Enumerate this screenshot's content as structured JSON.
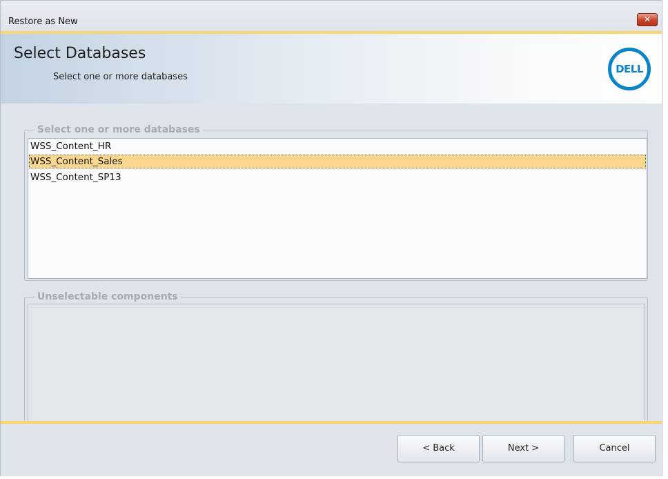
{
  "window": {
    "title": "Restore as New",
    "close_symbol": "✕"
  },
  "header": {
    "title": "Select Databases",
    "subtitle": "Select one or more databases",
    "logo_text": "DELL",
    "logo_color": "#0a84c6"
  },
  "databases_group": {
    "legend": "Select one or more databases",
    "items": [
      {
        "label": "WSS_Content_HR",
        "selected": false
      },
      {
        "label": "WSS_Content_Sales",
        "selected": true
      },
      {
        "label": "WSS_Content_SP13",
        "selected": false
      }
    ]
  },
  "unselectable_group": {
    "legend": "Unselectable components",
    "items": []
  },
  "buttons": {
    "back": "< Back",
    "next": "Next >",
    "cancel": "Cancel"
  },
  "colors": {
    "accent_rule": "#fbd66c",
    "selection": "#fbd88e",
    "close_button": "#c8442b"
  }
}
